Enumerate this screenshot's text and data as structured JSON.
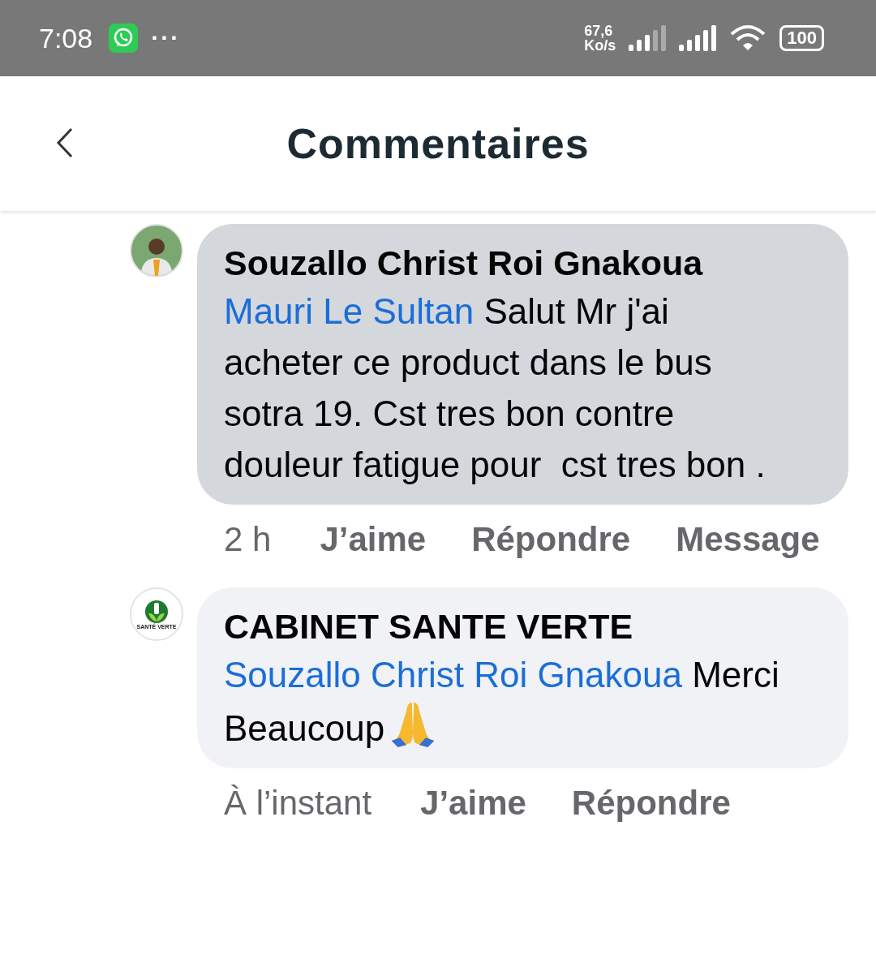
{
  "status_bar": {
    "time": "7:08",
    "more": "···",
    "speed_value": "67,6",
    "speed_unit": "Ko/s",
    "battery": "100"
  },
  "header": {
    "title": "Commentaires"
  },
  "comments": [
    {
      "author": "Souzallo Christ Roi Gnakoua",
      "mention": "Mauri Le Sultan",
      "text": " Salut Mr j'ai acheter ce product dans le bus sotra 19. Cst tres bon contre douleur fatigue pour  cst tres bon .",
      "highlighted": true,
      "kind": "photo",
      "emoji": false,
      "actions": [
        {
          "kind": "time",
          "label": "2 h"
        },
        {
          "kind": "action",
          "label": "J’aime"
        },
        {
          "kind": "action",
          "label": "Répondre"
        },
        {
          "kind": "action",
          "label": "Message"
        }
      ]
    },
    {
      "author": "CABINET SANTE VERTE",
      "mention": "Souzallo Christ Roi Gnakoua",
      "text": " Merci Beaucoup",
      "highlighted": false,
      "kind": "logo",
      "avatar_label": "SANTÉ VERTE",
      "emoji": true,
      "actions": [
        {
          "kind": "time",
          "label": "À l’instant"
        },
        {
          "kind": "action",
          "label": "J’aime"
        },
        {
          "kind": "action",
          "label": "Répondre"
        }
      ]
    }
  ]
}
